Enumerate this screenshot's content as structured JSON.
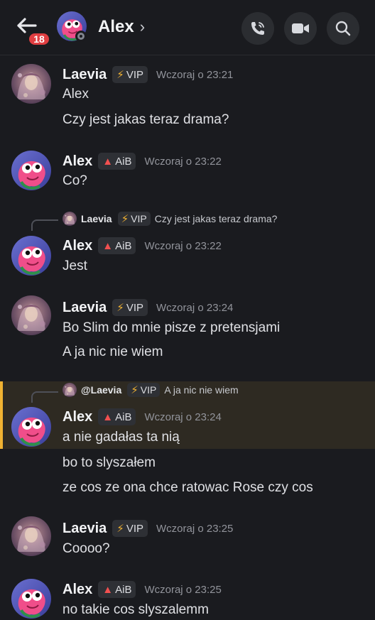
{
  "header": {
    "unread_count": "18",
    "title": "Alex",
    "chevron": "›",
    "status": "offline",
    "icons": [
      "back-arrow-icon",
      "phone-call-icon",
      "video-camera-icon",
      "search-icon"
    ]
  },
  "colors": {
    "background": "#1a1b1f",
    "badge": "#e03e41",
    "highlight_border": "#f0b232",
    "highlight_bg": "#2e2a22",
    "vip_icon": "#f0b232",
    "aib_icon": "#f25050"
  },
  "tags": {
    "vip_label": "VIP",
    "vip_icon": "⚡",
    "aib_label": "AiB",
    "aib_icon": "fire-icon"
  },
  "messages": [
    {
      "author": "Laevia",
      "tag": "VIP",
      "time": "Wczoraj o 23:21",
      "lines": [
        "Alex",
        "Czy jest jakas teraz drama?"
      ]
    },
    {
      "author": "Alex",
      "tag": "AiB",
      "time": "Wczoraj o 23:22",
      "lines": [
        "Co?"
      ]
    },
    {
      "reply": {
        "author": "Laevia",
        "tag": "VIP",
        "text": "Czy jest jakas teraz drama?"
      },
      "author": "Alex",
      "tag": "AiB",
      "time": "Wczoraj o 23:22",
      "lines": [
        "Jest"
      ]
    },
    {
      "author": "Laevia",
      "tag": "VIP",
      "time": "Wczoraj o 23:24",
      "lines": [
        "Bo Slim do mnie pisze z pretensjami",
        "A ja nic nie wiem"
      ]
    },
    {
      "reply": {
        "author": "@Laevia",
        "tag": "VIP",
        "text": "A ja nic nie wiem"
      },
      "highlighted": true,
      "author": "Alex",
      "tag": "AiB",
      "time": "Wczoraj o 23:24",
      "lines": [
        "a nie gadałas ta nią",
        "bo to slyszałem",
        "ze cos ze ona chce ratowac Rose czy cos"
      ]
    },
    {
      "author": "Laevia",
      "tag": "VIP",
      "time": "Wczoraj o 23:25",
      "lines": [
        "Coooo?"
      ]
    },
    {
      "author": "Alex",
      "tag": "AiB",
      "time": "Wczoraj o 23:25",
      "lines": [
        "no takie cos slyszalemm"
      ]
    }
  ]
}
